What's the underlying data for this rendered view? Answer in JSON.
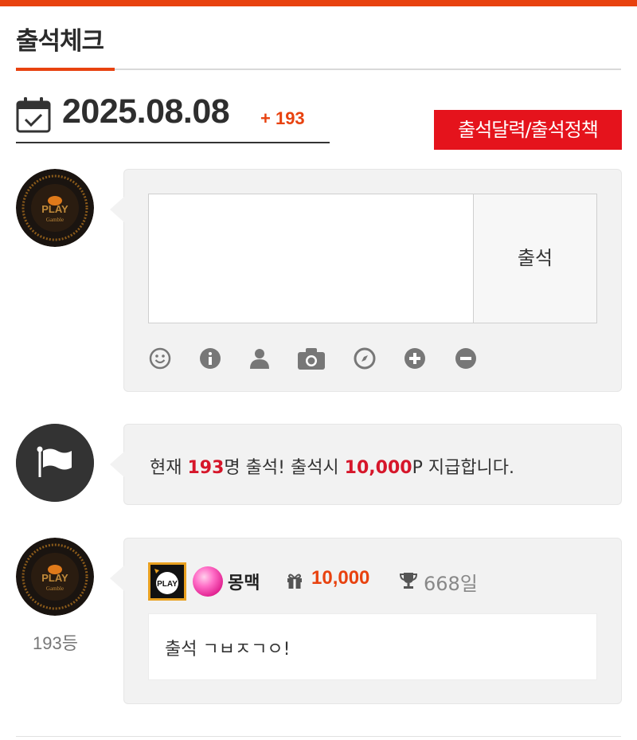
{
  "page": {
    "title": "출석체크"
  },
  "date_bar": {
    "date": "2025.08.08",
    "count": "+ 193"
  },
  "policy_button": {
    "label": "출석달력/출석정책"
  },
  "write": {
    "placeholder": "",
    "submit_label": "출석",
    "tools": [
      "smile-icon",
      "info-icon",
      "user-icon",
      "camera-icon",
      "compass-icon",
      "plus-circle-icon",
      "minus-circle-icon"
    ]
  },
  "notice": {
    "prefix": "현재 ",
    "count": "193",
    "middle": "명 출석! 출석시 ",
    "points": "10,000",
    "suffix": "P 지급합니다."
  },
  "entries": [
    {
      "rank": "193등",
      "nickname": "몽맥",
      "points": "10,000",
      "days": "668일",
      "message": "출석 ㄱㅂㅈㄱㅇ!"
    }
  ],
  "colors": {
    "accent": "#e8420f",
    "red": "#e5131c",
    "bubble": "#f2f2f2"
  }
}
